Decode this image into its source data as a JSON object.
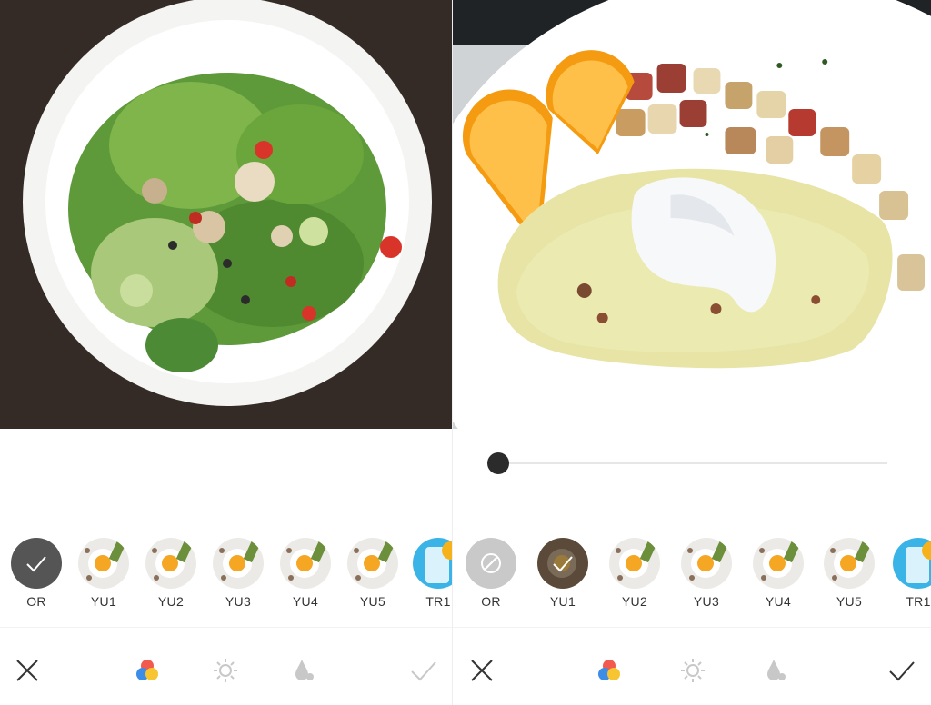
{
  "screens": [
    {
      "filters": [
        {
          "label": "OR",
          "kind": "original",
          "selected": true
        },
        {
          "label": "YU1",
          "kind": "egg"
        },
        {
          "label": "YU2",
          "kind": "egg"
        },
        {
          "label": "YU3",
          "kind": "egg"
        },
        {
          "label": "YU4",
          "kind": "egg"
        },
        {
          "label": "YU5",
          "kind": "egg"
        },
        {
          "label": "TR1",
          "kind": "drink"
        }
      ],
      "toolbar": {
        "cancel_icon": "close-icon",
        "filters_icon": "color-circles-icon",
        "brightness_icon": "sun-icon",
        "saturation_icon": "droplet-icon",
        "confirm_icon": "checkmark-icon"
      }
    },
    {
      "slider": {
        "value": 0
      },
      "filters": [
        {
          "label": "OR",
          "kind": "none"
        },
        {
          "label": "YU1",
          "kind": "egg",
          "selected": true
        },
        {
          "label": "YU2",
          "kind": "egg"
        },
        {
          "label": "YU3",
          "kind": "egg"
        },
        {
          "label": "YU4",
          "kind": "egg"
        },
        {
          "label": "YU5",
          "kind": "egg"
        },
        {
          "label": "TR1",
          "kind": "drink"
        }
      ],
      "toolbar": {
        "cancel_icon": "close-icon",
        "filters_icon": "color-circles-icon",
        "brightness_icon": "sun-icon",
        "saturation_icon": "droplet-icon",
        "confirm_icon": "checkmark-icon"
      }
    }
  ],
  "colors": {
    "selected_overlay": "#3a3a3a",
    "icon_gray": "#c8c8c8",
    "icon_dark": "#333333",
    "circle_red": "#f25a4f",
    "circle_blue": "#3b8de8",
    "circle_yellow": "#f7c531"
  }
}
